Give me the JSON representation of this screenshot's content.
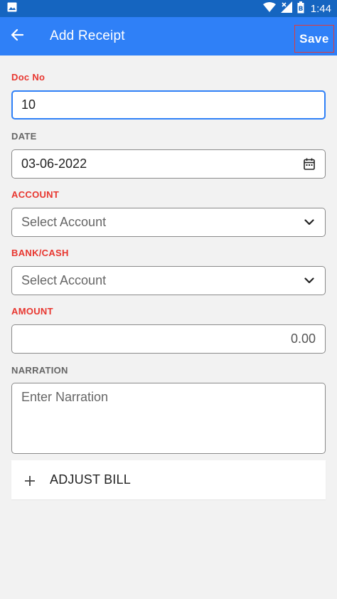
{
  "status_bar": {
    "time": "1:44",
    "icons": [
      "image-icon",
      "wifi-icon",
      "signal-icon",
      "battery-icon"
    ]
  },
  "app_bar": {
    "title": "Add Receipt",
    "save_label": "Save",
    "color": "#2f80f7"
  },
  "form": {
    "doc_no": {
      "label": "Doc No",
      "value": "10"
    },
    "date": {
      "label": "DATE",
      "value": "03-06-2022"
    },
    "account": {
      "label": "ACCOUNT",
      "placeholder": "Select Account"
    },
    "bank_cash": {
      "label": "BANK/CASH",
      "placeholder": "Select Account"
    },
    "amount": {
      "label": "AMOUNT",
      "value": "0.00"
    },
    "narration": {
      "label": "NARRATION",
      "placeholder": "Enter Narration"
    },
    "adjust_bill": {
      "label": "ADJUST BILL"
    }
  },
  "colors": {
    "required_label": "#e8362f",
    "optional_label": "#666666",
    "focus_border": "#2f80f7"
  }
}
